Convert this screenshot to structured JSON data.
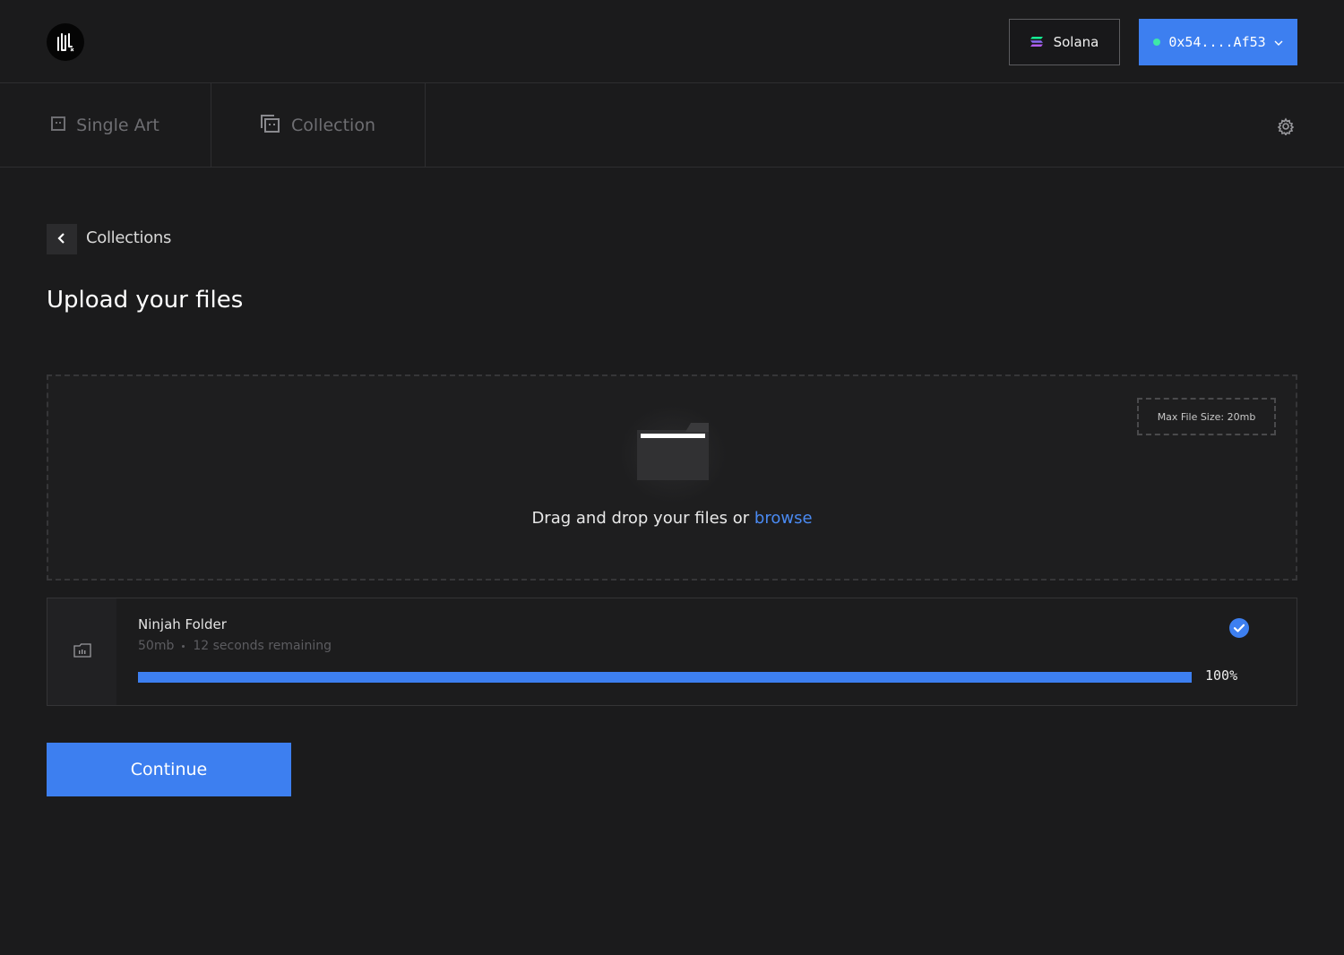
{
  "header": {
    "logo_icon": "waveform-logo-icon",
    "network": {
      "label": "Solana",
      "icon": "solana-logo-icon"
    },
    "wallet": {
      "address": "0x54....Af53",
      "status_color": "#3ee8a8",
      "icon": "chevron-down-icon"
    }
  },
  "tabs": [
    {
      "label": "Single Art",
      "icon": "image-icon"
    },
    {
      "label": "Collection",
      "icon": "stacked-images-icon"
    }
  ],
  "breadcrumb": {
    "label": "Collections",
    "back_icon": "chevron-left-icon"
  },
  "page": {
    "title": "Upload your files"
  },
  "dropzone": {
    "max_size": "Max File Size: 20mb",
    "prompt": "Drag and drop your files or",
    "browse_label": "browse",
    "icon": "folder-icon"
  },
  "file": {
    "name": "Ninjah Folder",
    "size": "50mb",
    "remaining": "12 seconds remaining",
    "progress_label": "100%",
    "progress": 1.0,
    "status_icon": "check-circle-icon"
  },
  "actions": {
    "continue_label": "Continue"
  },
  "colors": {
    "accent": "#3d7ff0",
    "background": "#1b1b1c",
    "link": "#4a8af2"
  }
}
